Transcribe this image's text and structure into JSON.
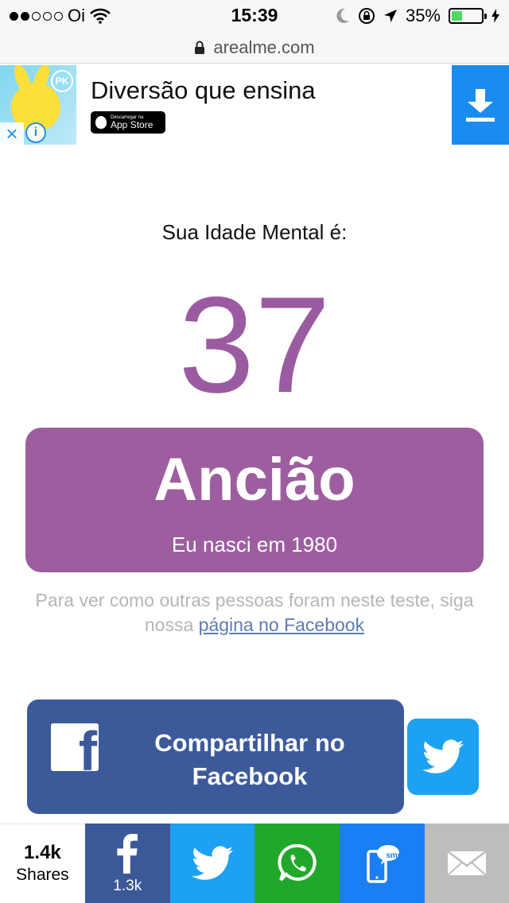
{
  "status_bar": {
    "carrier": "Oi",
    "time": "15:39",
    "battery": "35%",
    "battery_level": 0.35,
    "battery_color": "#4cd964"
  },
  "url_bar": {
    "domain": "arealme.com",
    "icon": "lock-icon"
  },
  "ad": {
    "headline": "Diversão que ensina",
    "badge_small": "Descarregar na",
    "badge_big": "App Store",
    "badge_logo_text": "PK",
    "icons": [
      "close-icon",
      "info-icon",
      "download-icon"
    ]
  },
  "result": {
    "label": "Sua Idade Mental é:",
    "age": "37",
    "title": "Ancião",
    "subtitle": "Eu nasci em 1980",
    "note_text": "Para ver como outras pessoas foram neste teste, siga nossa ",
    "note_link": "página no Facebook"
  },
  "share": {
    "facebook_label": "Compartilhar no Facebook",
    "twitter_icon": "twitter-icon"
  },
  "share_bar": {
    "count": "1.4k",
    "count_label": "Shares",
    "facebook_count": "1.3k",
    "sms_label": "sms"
  },
  "colors": {
    "accent": "#9d5ea0",
    "facebook": "#3c5a9a",
    "twitter": "#1da1f2",
    "whatsapp": "#20a82b",
    "sms": "#1a7ef5",
    "email": "#bdbdbd"
  }
}
